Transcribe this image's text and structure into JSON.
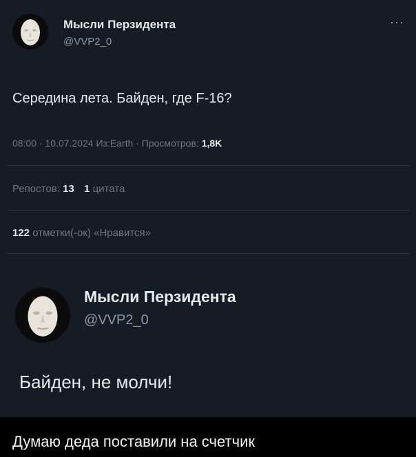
{
  "tweet1": {
    "author_name": "Мысли Перзидента",
    "author_handle": "@VVP2_0",
    "more_icon": "···",
    "text": "Середина лета. Байден, где F-16?",
    "time": "08:00",
    "dot": "·",
    "date": "10.07.2024",
    "source": "Из:Earth",
    "views_label": "Просмотров:",
    "views_value": "1,8K",
    "reposts_label": "Репостов:",
    "reposts_value": "13",
    "quotes_value": "1",
    "quotes_label": "цитата",
    "likes_value": "122",
    "likes_label": "отметки(-ок) «Нравится»"
  },
  "tweet2": {
    "author_name": "Мысли Перзидента",
    "author_handle": "@VVP2_0",
    "text": "Байден, не молчи!"
  },
  "caption": "Думаю деда поставили на счетчик",
  "colors": {
    "background": "#151c26",
    "text": "#e7e9ea",
    "muted": "#6e7781",
    "caption_bar": "#000000"
  }
}
